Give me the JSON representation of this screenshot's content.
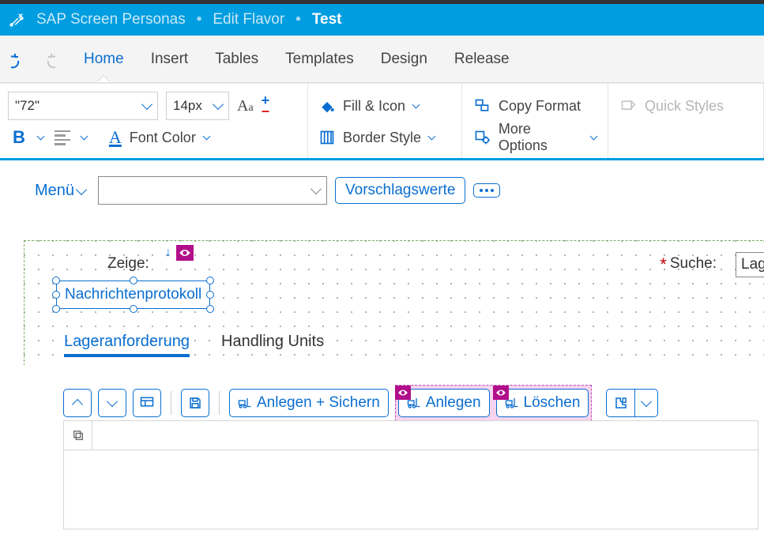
{
  "titlebar": {
    "app": "SAP Screen Personas",
    "mode": "Edit Flavor",
    "flavor": "Test"
  },
  "tabs": {
    "home": "Home",
    "insert": "Insert",
    "tables": "Tables",
    "templates": "Templates",
    "design": "Design",
    "release": "Release"
  },
  "ribbon": {
    "fontFamily": "\"72\"",
    "fontSize": "14px",
    "fontColor": "Font Color",
    "fillIcon": "Fill & Icon",
    "borderStyle": "Border Style",
    "copyFormat": "Copy Format",
    "moreOptions": "More Options",
    "quickStyles": "Quick Styles"
  },
  "menu": {
    "label": "Menü",
    "suggest": "Vorschlagswerte"
  },
  "surface": {
    "zeige": "Zeige:",
    "suche": "Suche:",
    "lage": "Lage",
    "selected": "Nachrichtenprotokoll",
    "innerTabs": {
      "t1": "Lageranforderung",
      "t2": "Handling Units"
    },
    "buttons": {
      "anlegenSichern": "Anlegen + Sichern",
      "anlegen": "Anlegen",
      "loeschen": "Löschen"
    }
  }
}
